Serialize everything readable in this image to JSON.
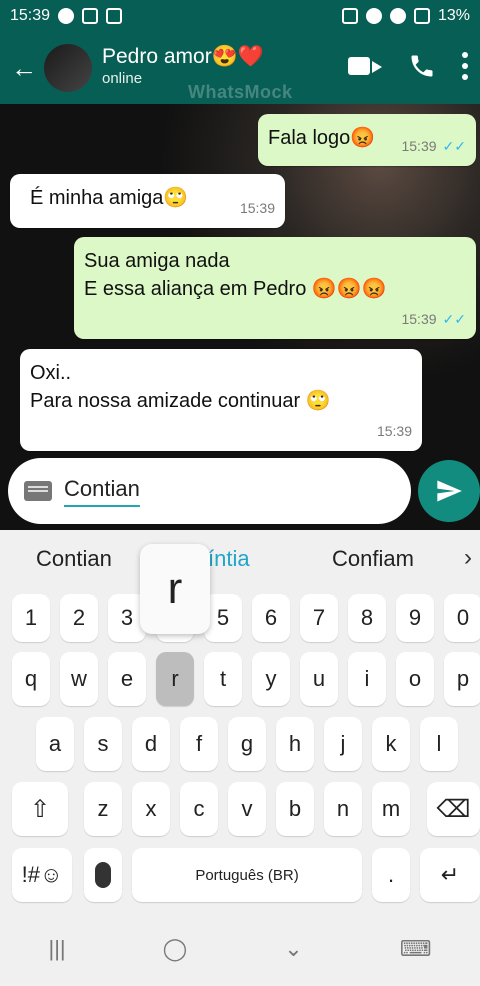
{
  "status_bar": {
    "time": "15:39",
    "battery": "13%"
  },
  "header": {
    "name": "Pedro amor😍❤️",
    "status": "online",
    "watermark": "WhatsMock"
  },
  "messages": [
    {
      "id": "m1",
      "direction": "outgoing",
      "text": "Fala logo😡",
      "time": "15:39",
      "ticks": "✓✓"
    },
    {
      "id": "m2",
      "direction": "incoming",
      "text": "É minha amiga🙄",
      "time": "15:39"
    },
    {
      "id": "m3",
      "direction": "outgoing",
      "lines": [
        "Sua amiga nada",
        "E essa aliança em Pedro 😡😡😡"
      ],
      "time": "15:39",
      "ticks": "✓✓"
    },
    {
      "id": "m4",
      "direction": "incoming",
      "lines": [
        "Oxi..",
        "Para nossa amizade continuar 🙄"
      ],
      "time": "15:39"
    }
  ],
  "composer": {
    "text": "Contian"
  },
  "keyboard": {
    "suggestions": [
      "Contian",
      "íntia",
      "Confiam"
    ],
    "popup_key": "r",
    "row_numbers": [
      "1",
      "2",
      "3",
      "4",
      "5",
      "6",
      "7",
      "8",
      "9",
      "0"
    ],
    "row1": [
      "q",
      "w",
      "e",
      "r",
      "t",
      "y",
      "u",
      "i",
      "o",
      "p"
    ],
    "row2": [
      "a",
      "s",
      "d",
      "f",
      "g",
      "h",
      "j",
      "k",
      "l"
    ],
    "row3": [
      "z",
      "x",
      "c",
      "v",
      "b",
      "n",
      "m"
    ],
    "bottom": {
      "symbols": "!#☺",
      "space": "Português (BR)",
      "period": ".",
      "enter": "↵"
    }
  }
}
